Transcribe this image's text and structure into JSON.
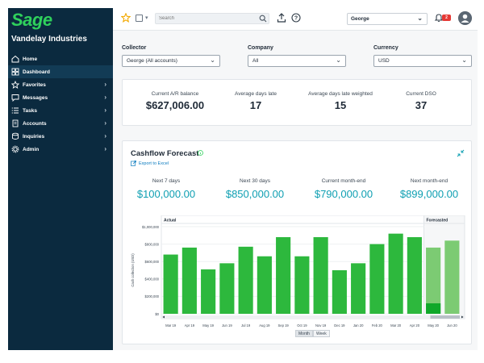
{
  "app": {
    "logo": "Sage",
    "company": "Vandelay Industries"
  },
  "sidebar": {
    "items": [
      {
        "label": "Home",
        "icon": "home-icon",
        "chevron": false,
        "active": false
      },
      {
        "label": "Dashboard",
        "icon": "dashboard-icon",
        "chevron": false,
        "active": true
      },
      {
        "label": "Favorites",
        "icon": "star-icon",
        "chevron": true,
        "active": false
      },
      {
        "label": "Messages",
        "icon": "message-icon",
        "chevron": true,
        "active": false
      },
      {
        "label": "Tasks",
        "icon": "tasks-icon",
        "chevron": true,
        "active": false
      },
      {
        "label": "Accounts",
        "icon": "accounts-icon",
        "chevron": true,
        "active": false
      },
      {
        "label": "Inquiries",
        "icon": "inquiries-icon",
        "chevron": true,
        "active": false
      },
      {
        "label": "Admin",
        "icon": "gear-icon",
        "chevron": true,
        "active": false
      }
    ]
  },
  "topbar": {
    "search_placeholder": "Search",
    "user": "George",
    "notification_count": "2"
  },
  "filters": {
    "collector": {
      "label": "Collector",
      "value": "George (All accounts)"
    },
    "company": {
      "label": "Company",
      "value": "All"
    },
    "currency": {
      "label": "Currency",
      "value": "USD"
    }
  },
  "kpis": [
    {
      "label": "Current A/R balance",
      "value": "$627,006.00"
    },
    {
      "label": "Average days late",
      "value": "17"
    },
    {
      "label": "Average days late weighted",
      "value": "15"
    },
    {
      "label": "Current DSO",
      "value": "37"
    }
  ],
  "cashflow": {
    "title": "Cashflow Forecast",
    "export_label": "Export to Excel",
    "kpis": [
      {
        "label": "Next 7 days",
        "value": "$100,000.00"
      },
      {
        "label": "Next 30 days",
        "value": "$850,000.00"
      },
      {
        "label": "Current month-end",
        "value": "$790,000.00"
      },
      {
        "label": "Next month-end",
        "value": "$899,000.00"
      }
    ],
    "toggles": {
      "month": "Month",
      "week": "Week"
    }
  },
  "colors": {
    "sidebar": "#0b2a3f",
    "brand_green": "#2fd15c",
    "bar_actual": "#2db83d",
    "bar_forecast": "#7ccb73",
    "kpi_teal": "#0e9fb2"
  },
  "chart_data": {
    "type": "bar",
    "ylabel": "Cash collection (USD)",
    "ylim": [
      0,
      1000000
    ],
    "yticks": [
      "$0",
      "$200,000",
      "$400,000",
      "$600,000",
      "$800,000",
      "$1,000,000"
    ],
    "regions": {
      "actual": "Actual",
      "forecast": "Forecasted"
    },
    "categories": [
      "Mar 19",
      "Apr 19",
      "May 19",
      "Jun 19",
      "Jul 19",
      "Aug 19",
      "Sep 19",
      "Oct 19",
      "Nov 19",
      "Dec 19",
      "Jan 20",
      "Feb 20",
      "Mar 20",
      "Apr 20",
      "May 20",
      "Jun 20"
    ],
    "series": [
      {
        "name": "Actual",
        "values": [
          680000,
          760000,
          510000,
          580000,
          770000,
          660000,
          880000,
          660000,
          880000,
          500000,
          580000,
          800000,
          920000,
          880000,
          0,
          0
        ]
      },
      {
        "name": "Forecasted",
        "values": [
          0,
          0,
          0,
          0,
          0,
          0,
          0,
          0,
          0,
          0,
          0,
          0,
          0,
          0,
          760000,
          840000
        ]
      }
    ],
    "forecast_portion_actual": [
      0,
      0,
      0,
      0,
      0,
      0,
      0,
      0,
      0,
      0,
      0,
      0,
      0,
      0,
      120000,
      0
    ]
  }
}
